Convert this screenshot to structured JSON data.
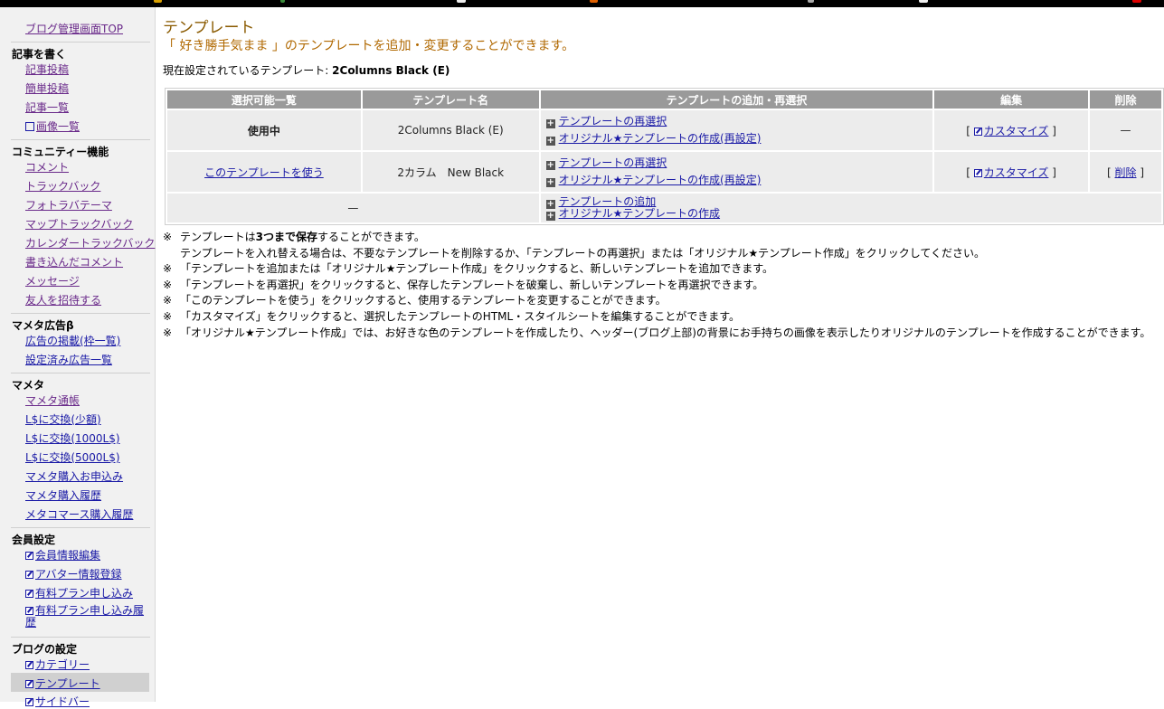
{
  "sidebar": {
    "top_link": "ブログ管理画面TOP",
    "sections": [
      {
        "title": "記事を書く",
        "items": [
          "記事投稿",
          "簡単投稿",
          "記事一覧",
          "画像一覧"
        ]
      },
      {
        "title": "コミュニティー機能",
        "items": [
          "コメント",
          "トラックバック",
          "フォトラバテーマ",
          "マップトラックバック",
          "カレンダートラックバック",
          "書き込んだコメント",
          "メッセージ",
          "友人を招待する"
        ]
      },
      {
        "title": "マメタ広告β",
        "items": [
          "広告の掲載(枠一覧)",
          "設定済み広告一覧"
        ]
      },
      {
        "title": "マメタ",
        "items": [
          "マメタ通帳",
          "L$に交換(少額)",
          "L$に交換(1000L$)",
          "L$に交換(5000L$)",
          "マメタ購入お申込み",
          "マメタ購入履歴",
          "メタコマース購入履歴"
        ]
      },
      {
        "title": "会員設定",
        "items": [
          "会員情報編集",
          "アバター情報登録",
          "有料プラン申し込み",
          "有料プラン申し込み履歴"
        ]
      },
      {
        "title": "ブログの設定",
        "items": [
          "カテゴリー",
          "テンプレート",
          "サイドバー"
        ]
      }
    ]
  },
  "page": {
    "title": "テンプレート",
    "subtitle": "「 好き勝手気まま 」のテンプレートを追加・変更することができます。",
    "current_label": "現在設定されているテンプレート:",
    "current_value": "2Columns Black (E)"
  },
  "table": {
    "headers": [
      "選択可能一覧",
      "テンプレート名",
      "テンプレートの追加・再選択",
      "編集",
      "削除"
    ],
    "rows": [
      {
        "status": "使用中",
        "name": "2Columns Black (E)",
        "link1": "テンプレートの再選択",
        "link2": "オリジナル★テンプレートの作成(再設定)",
        "edit": "カスタマイズ",
        "delete": "—"
      },
      {
        "status": "このテンプレートを使う",
        "name": "2カラム　New Black",
        "link1": "テンプレートの再選択",
        "link2": "オリジナル★テンプレートの作成(再設定)",
        "edit": "カスタマイズ",
        "delete": "削除"
      },
      {
        "status": "—",
        "link1": "テンプレートの追加",
        "link2": "オリジナル★テンプレートの作成"
      }
    ],
    "bracket_open": "[",
    "bracket_close": "]"
  },
  "notes": {
    "mark": "※",
    "n1_pre": "テンプレートは",
    "n1_bold": "3つまで保存",
    "n1_post": "することができます。",
    "n1_line2": "テンプレートを入れ替える場合は、不要なテンプレートを削除するか、「テンプレートの再選択」または「オリジナル★テンプレート作成」をクリックしてください。",
    "n2": "「テンプレートを追加または「オリジナル★テンプレート作成」をクリックすると、新しいテンプレートを追加できます。",
    "n3": "「テンプレートを再選択」をクリックすると、保存したテンプレートを破棄し、新しいテンプレートを再選択できます。",
    "n4": "「このテンプレートを使う」をクリックすると、使用するテンプレートを変更することができます。",
    "n5": "「カスタマイズ」をクリックすると、選択したテンプレートのHTML・スタイルシートを編集することができます。",
    "n6": "「オリジナル★テンプレート作成」では、お好きな色のテンプレートを作成したり、ヘッダー(ブログ上部)の背景にお手持ちの画像を表示したりオリジナルのテンプレートを作成することができます。"
  }
}
